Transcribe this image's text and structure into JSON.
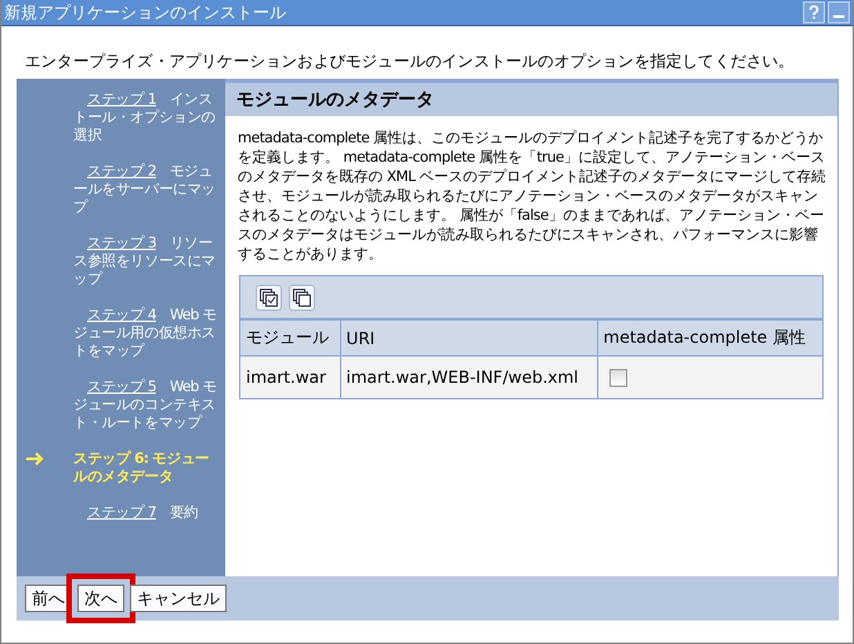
{
  "window": {
    "title": "新規アプリケーションのインストール"
  },
  "instruction": "エンタープライズ・アプリケーションおよびモジュールのインストールのオプションを指定してください。",
  "steps": [
    {
      "label": "ステップ 1",
      "text": "インストール・オプションの選択",
      "selected": false
    },
    {
      "label": "ステップ 2",
      "text": "モジュールをサーバーにマップ",
      "selected": false
    },
    {
      "label": "ステップ 3",
      "text": "リソース参照をリソースにマップ",
      "selected": false
    },
    {
      "label": "ステップ 4",
      "text": "Web モジュール用の仮想ホストをマップ",
      "selected": false
    },
    {
      "label": "ステップ 5",
      "text": "Web モジュールのコンテキスト・ルートをマップ",
      "selected": false
    },
    {
      "label": "ステップ 6:",
      "text": "モジュールのメタデータ",
      "selected": true
    },
    {
      "label": "ステップ 7",
      "text": "要約",
      "selected": false
    }
  ],
  "panel": {
    "title": "モジュールのメタデータ",
    "description": "metadata-complete 属性は、このモジュールのデプロイメント記述子を完了するかどうかを定義します。 metadata-complete 属性を「true」に設定して、アノテーション・ベースのメタデータを既存の XML ベースのデプロイメント記述子のメタデータにマージして存続させ、モジュールが読み取られるたびにアノテーション・ベースのメタデータがスキャンされることのないようにします。 属性が「false」のままであれば、アノテーション・ベースのメタデータはモジュールが読み取られるたびにスキャンされ、パフォーマンスに影響することがあります。"
  },
  "table": {
    "columns": [
      "モジュール",
      "URI",
      "metadata-complete 属性"
    ],
    "rows": [
      {
        "cells": [
          "imart.war",
          "imart.war,WEB-INF/web.xml"
        ],
        "checked": false
      }
    ]
  },
  "buttons": [
    {
      "label": "前へ",
      "highlighted": false
    },
    {
      "label": "次へ",
      "highlighted": true
    },
    {
      "label": "キャンセル",
      "highlighted": false
    }
  ]
}
